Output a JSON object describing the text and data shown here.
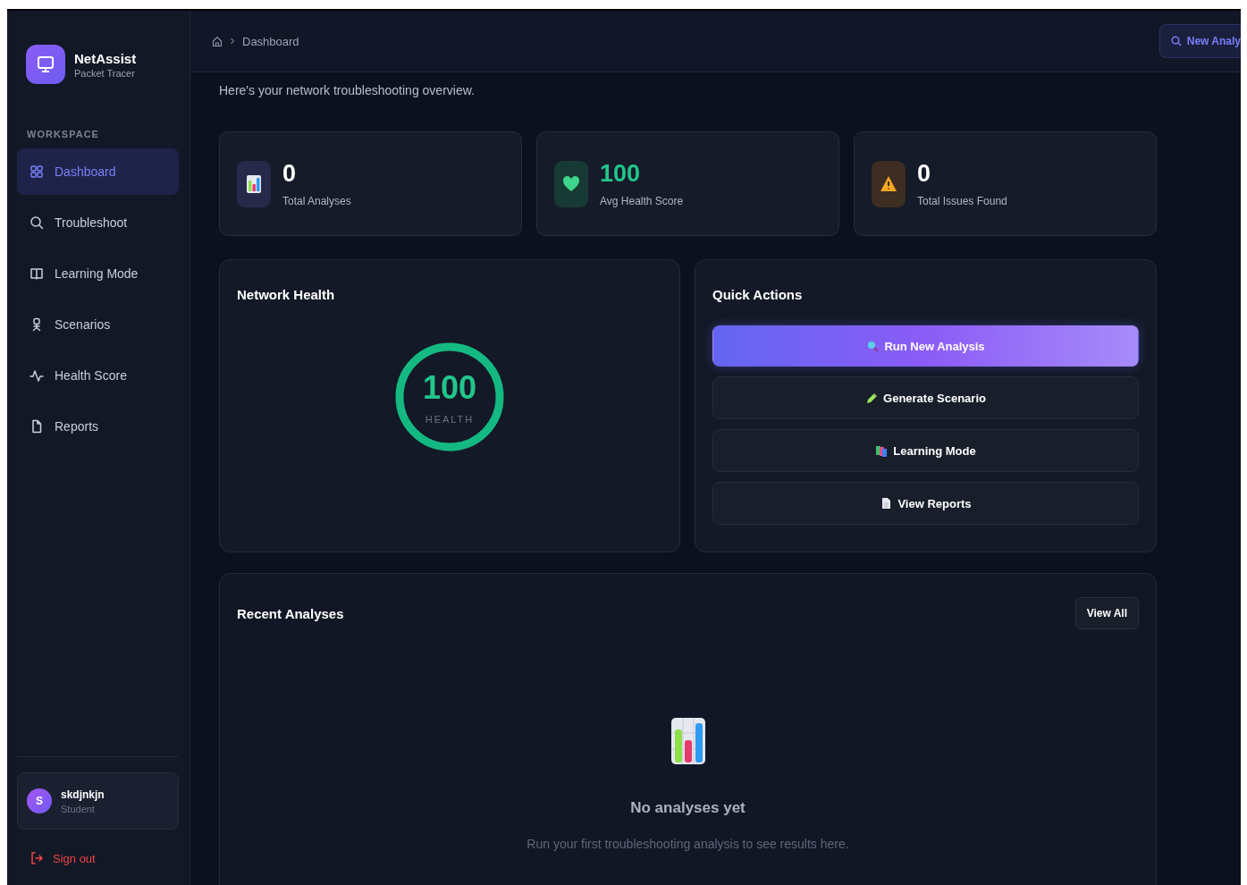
{
  "sidebar": {
    "brand": {
      "name": "NetAssist",
      "subtitle": "Packet Tracer"
    },
    "section_label": "WORKSPACE",
    "items": [
      {
        "label": "Dashboard",
        "selected": true
      },
      {
        "label": "Troubleshoot",
        "selected": false
      },
      {
        "label": "Learning Mode",
        "selected": false
      },
      {
        "label": "Scenarios",
        "selected": false
      },
      {
        "label": "Health Score",
        "selected": false
      },
      {
        "label": "Reports",
        "selected": false
      }
    ],
    "user": {
      "initial": "S",
      "name": "skdjnkjn",
      "role": "Student"
    },
    "sign_out": "Sign out"
  },
  "topbar": {
    "breadcrumb": "Dashboard",
    "button": "New Analy"
  },
  "subtitle": "Here's your network troubleshooting overview.",
  "stats": [
    {
      "value": "0",
      "label": "Total Analyses",
      "color": "#ffffff"
    },
    {
      "value": "100",
      "label": "Avg Health Score",
      "color": "#22c58b"
    },
    {
      "value": "0",
      "label": "Total Issues Found",
      "color": "#ffffff"
    }
  ],
  "network_health": {
    "title": "Network Health",
    "value": "100",
    "label": "HEALTH",
    "level": 1
  },
  "quick_actions": {
    "title": "Quick Actions",
    "items": [
      {
        "label": "Run New Analysis",
        "primary": true
      },
      {
        "label": "Generate Scenario",
        "primary": false
      },
      {
        "label": "Learning Mode",
        "primary": false
      },
      {
        "label": "View Reports",
        "primary": false
      }
    ]
  },
  "recent": {
    "title": "Recent Analyses",
    "button": "View All",
    "empty_title": "No analyses yet",
    "empty_text": "Run your first troubleshooting analysis to see results here."
  }
}
